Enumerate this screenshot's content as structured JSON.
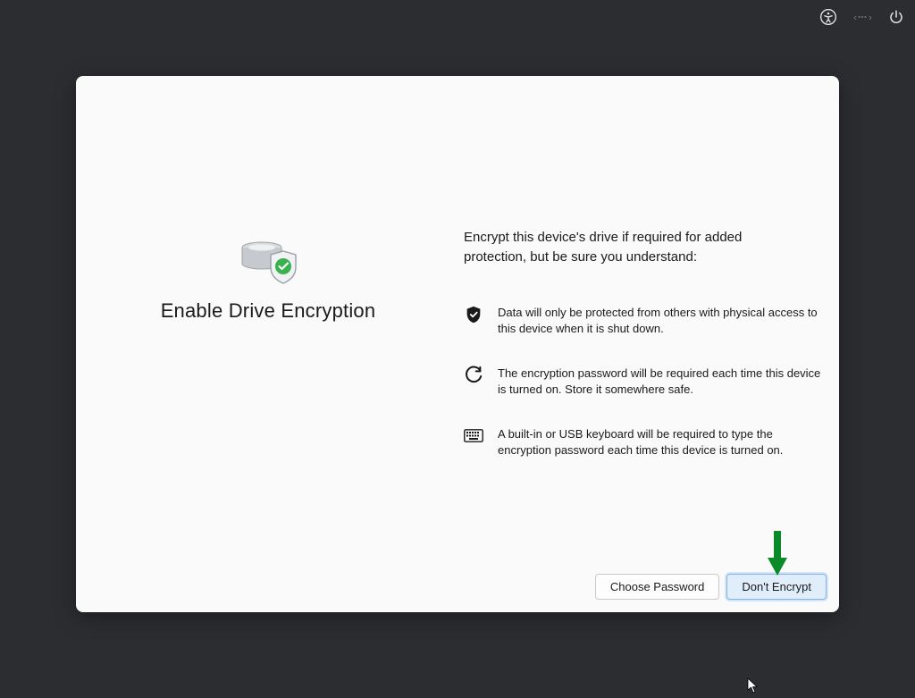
{
  "topbar": {
    "accessibility_icon": "accessibility",
    "lang_icon": "language-options",
    "power_icon": "power"
  },
  "main": {
    "title": "Enable Drive Encryption",
    "intro": "Encrypt this device's drive if required for added protection, but be sure you understand:",
    "points": [
      {
        "icon": "shield-check-icon",
        "text": "Data will only be protected from others with physical access to this device when it is shut down."
      },
      {
        "icon": "refresh-icon",
        "text": "The encryption password will be required each time this device is turned on. Store it somewhere safe."
      },
      {
        "icon": "keyboard-icon",
        "text": "A built-in or USB keyboard will be required to type the encryption password each time this device is turned on."
      }
    ]
  },
  "actions": {
    "choose_password": "Choose Password",
    "dont_encrypt": "Don't Encrypt"
  },
  "annotation": {
    "arrow_target": "dont-encrypt-button"
  }
}
